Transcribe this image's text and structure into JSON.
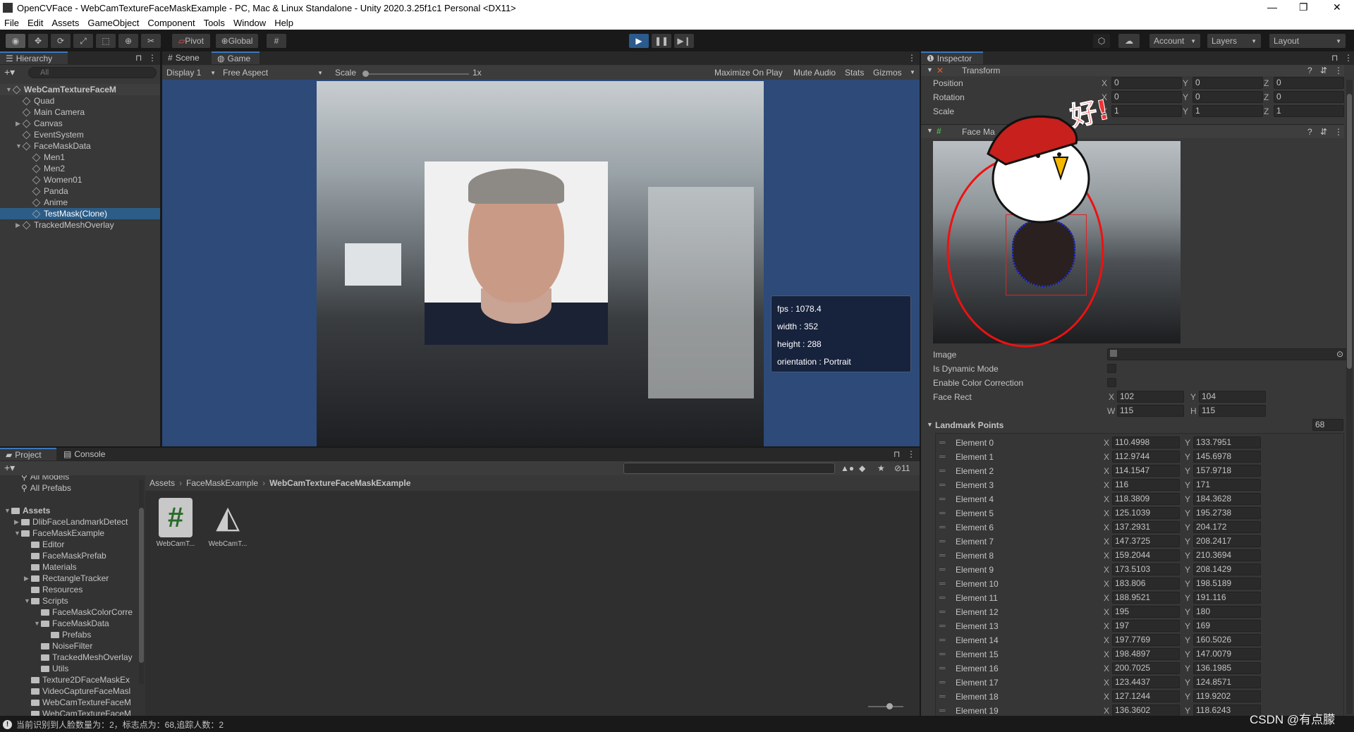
{
  "window": {
    "title": "OpenCVFace - WebCamTextureFaceMaskExample - PC, Mac & Linux Standalone - Unity 2020.3.25f1c1 Personal <DX11>",
    "minimize": "—",
    "maximize": "❐",
    "close": "✕"
  },
  "menu": [
    "File",
    "Edit",
    "Assets",
    "GameObject",
    "Component",
    "Tools",
    "Window",
    "Help"
  ],
  "toolbar": {
    "pivot": "Pivot",
    "global": "Global",
    "account": "Account",
    "layers": "Layers",
    "layout": "Layout",
    "accent": "#2b5a8c"
  },
  "hierarchy": {
    "tab": "Hierarchy",
    "search_placeholder": "All",
    "items": [
      {
        "label": "WebCamTextureFaceM",
        "depth": 0,
        "arrow": "▼",
        "root": true
      },
      {
        "label": "Quad",
        "depth": 1
      },
      {
        "label": "Main Camera",
        "depth": 1
      },
      {
        "label": "Canvas",
        "depth": 1,
        "arrow": "▶"
      },
      {
        "label": "EventSystem",
        "depth": 1
      },
      {
        "label": "FaceMaskData",
        "depth": 1,
        "arrow": "▼"
      },
      {
        "label": "Men1",
        "depth": 2
      },
      {
        "label": "Men2",
        "depth": 2
      },
      {
        "label": "Women01",
        "depth": 2
      },
      {
        "label": "Panda",
        "depth": 2
      },
      {
        "label": "Anime",
        "depth": 2
      },
      {
        "label": "TestMask(Clone)",
        "depth": 2,
        "selected": true
      },
      {
        "label": "TrackedMeshOverlay",
        "depth": 1,
        "arrow": "▶"
      }
    ]
  },
  "game": {
    "tabs": [
      "Scene",
      "Game"
    ],
    "display": "Display 1",
    "aspect": "Free Aspect",
    "scale_label": "Scale",
    "scale_value": "1x",
    "maximize": "Maximize On Play",
    "mute": "Mute Audio",
    "stats": "Stats",
    "gizmos": "Gizmos",
    "info": [
      "fps : 1078.4",
      "width : 352",
      "height : 288",
      "orientation : Portrait"
    ]
  },
  "inspector": {
    "tab": "Inspector",
    "transform_title": "Transform",
    "transform": [
      {
        "label": "Position",
        "x": "0",
        "y": "0",
        "z": "0"
      },
      {
        "label": "Rotation",
        "x": "0",
        "y": "0",
        "z": "0"
      },
      {
        "label": "Scale",
        "x": "1",
        "y": "1",
        "z": "1"
      }
    ],
    "component_title": "Face Ma",
    "sticker_text": "好!",
    "image_label": "Image",
    "dynamic_label": "Is Dynamic Mode",
    "color_label": "Enable Color Correction",
    "dynamic_checked": false,
    "color_checked": false,
    "face_rect_label": "Face Rect",
    "face_rect": {
      "x": "102",
      "y": "104",
      "w": "115",
      "h": "115"
    },
    "landmark_label": "Landmark Points",
    "landmark_count": "68",
    "elements": [
      {
        "label": "Element 0",
        "x": "110.4998",
        "y": "133.7951"
      },
      {
        "label": "Element 1",
        "x": "112.9744",
        "y": "145.6978"
      },
      {
        "label": "Element 2",
        "x": "114.1547",
        "y": "157.9718"
      },
      {
        "label": "Element 3",
        "x": "116",
        "y": "171"
      },
      {
        "label": "Element 4",
        "x": "118.3809",
        "y": "184.3628"
      },
      {
        "label": "Element 5",
        "x": "125.1039",
        "y": "195.2738"
      },
      {
        "label": "Element 6",
        "x": "137.2931",
        "y": "204.172"
      },
      {
        "label": "Element 7",
        "x": "147.3725",
        "y": "208.2417"
      },
      {
        "label": "Element 8",
        "x": "159.2044",
        "y": "210.3694"
      },
      {
        "label": "Element 9",
        "x": "173.5103",
        "y": "208.1429"
      },
      {
        "label": "Element 10",
        "x": "183.806",
        "y": "198.5189"
      },
      {
        "label": "Element 11",
        "x": "188.9521",
        "y": "191.116"
      },
      {
        "label": "Element 12",
        "x": "195",
        "y": "180"
      },
      {
        "label": "Element 13",
        "x": "197",
        "y": "169"
      },
      {
        "label": "Element 14",
        "x": "197.7769",
        "y": "160.5026"
      },
      {
        "label": "Element 15",
        "x": "198.4897",
        "y": "147.0079"
      },
      {
        "label": "Element 16",
        "x": "200.7025",
        "y": "136.1985"
      },
      {
        "label": "Element 17",
        "x": "123.4437",
        "y": "124.8571"
      },
      {
        "label": "Element 18",
        "x": "127.1244",
        "y": "119.9202"
      },
      {
        "label": "Element 19",
        "x": "136.3602",
        "y": "118.6243"
      }
    ]
  },
  "project": {
    "tabs": [
      "Project",
      "Console"
    ],
    "hidden_count": "11",
    "breadcrumb": [
      "Assets",
      "FaceMaskExample",
      "WebCamTextureFaceMaskExample"
    ],
    "tree": [
      {
        "label": "All Models",
        "depth": 1,
        "search": true
      },
      {
        "label": "All Prefabs",
        "depth": 1,
        "search": true
      },
      {
        "label": "",
        "depth": 0
      },
      {
        "label": "Assets",
        "depth": 0,
        "arrow": "▼",
        "bold": true
      },
      {
        "label": "DlibFaceLandmarkDetect",
        "depth": 1,
        "arrow": "▶"
      },
      {
        "label": "FaceMaskExample",
        "depth": 1,
        "arrow": "▼"
      },
      {
        "label": "Editor",
        "depth": 2
      },
      {
        "label": "FaceMaskPrefab",
        "depth": 2
      },
      {
        "label": "Materials",
        "depth": 2
      },
      {
        "label": "RectangleTracker",
        "depth": 2,
        "arrow": "▶"
      },
      {
        "label": "Resources",
        "depth": 2
      },
      {
        "label": "Scripts",
        "depth": 2,
        "arrow": "▼"
      },
      {
        "label": "FaceMaskColorCorre",
        "depth": 3
      },
      {
        "label": "FaceMaskData",
        "depth": 3,
        "arrow": "▼"
      },
      {
        "label": "Prefabs",
        "depth": 4
      },
      {
        "label": "NoiseFilter",
        "depth": 3
      },
      {
        "label": "TrackedMeshOverlay",
        "depth": 3
      },
      {
        "label": "Utils",
        "depth": 3
      },
      {
        "label": "Texture2DFaceMaskEx",
        "depth": 2
      },
      {
        "label": "VideoCaptureFaceMasl",
        "depth": 2
      },
      {
        "label": "WebCamTextureFaceM",
        "depth": 2
      },
      {
        "label": "WebCamTextureFaceM",
        "depth": 2
      }
    ],
    "assets": [
      {
        "label": "WebCamT...",
        "icon": "csharp-script-icon"
      },
      {
        "label": "WebCamT...",
        "icon": "unity-scene-icon"
      }
    ]
  },
  "status": {
    "message": "当前识别到人脸数量为：2，标志点为：68,追踪人数：2"
  },
  "watermark": "CSDN @有点朦"
}
